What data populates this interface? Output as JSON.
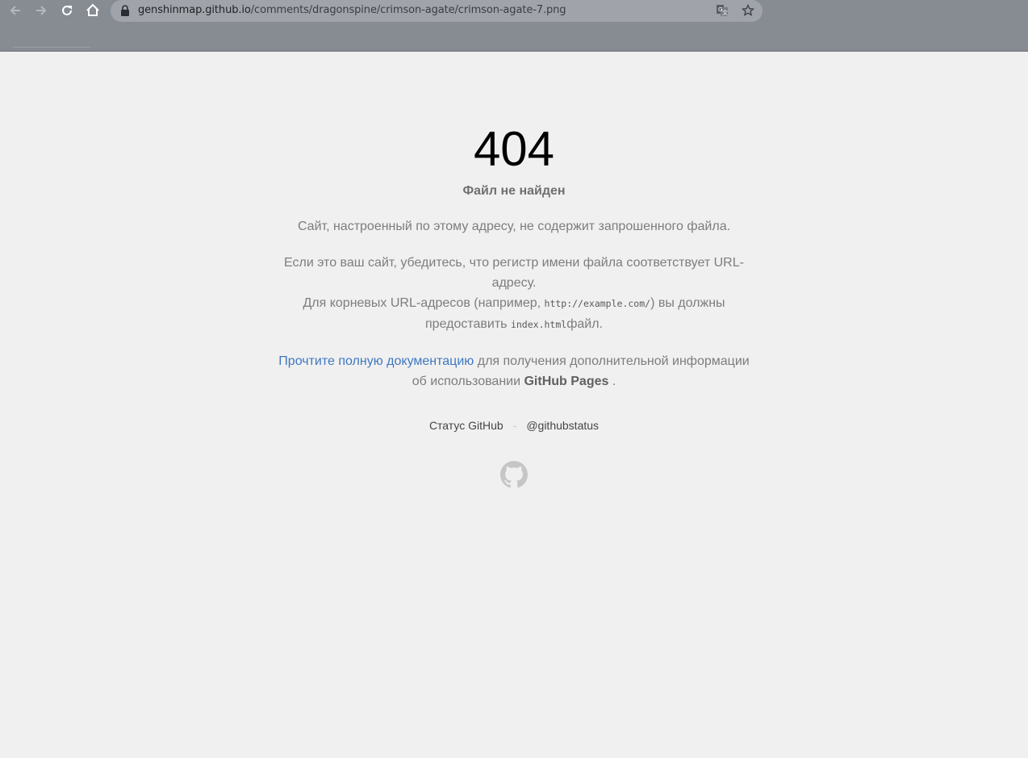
{
  "browser": {
    "url_host": "genshinmap.github.io",
    "url_path": "/comments/dragonspine/crimson-agate/crimson-agate-7.png",
    "icons": [
      "back-icon",
      "forward-icon",
      "reload-icon",
      "home-icon",
      "lock-icon",
      "translate-icon",
      "star-icon"
    ]
  },
  "page": {
    "code": "404",
    "heading": "Файл не найден",
    "paragraph1": "Сайт, настроенный по этому адресу, не содержит запрошенного файла.",
    "paragraph2_line1": "Если это ваш сайт, убедитесь, что регистр имени файла соответствует URL-адресу.",
    "paragraph2_line2_pre": "Для корневых URL-адресов (например, ",
    "paragraph2_code1": "http://example.com/",
    "paragraph2_line2_mid": ") вы должны предоставить ",
    "paragraph2_code2": "index.html",
    "paragraph2_line2_post": "файл.",
    "doc_link": "Прочтите полную документацию",
    "doc_text": " для получения дополнительной информации об использовании ",
    "doc_strong": "GitHub Pages",
    "doc_end": " .",
    "footer_status": "Статус GitHub",
    "footer_sep": "-",
    "footer_twitter": "@githubstatus"
  },
  "colors": {
    "background": "#f0f0f0",
    "link": "#4078c0",
    "text": "#7d7d7d",
    "chrome": "#878c93"
  }
}
